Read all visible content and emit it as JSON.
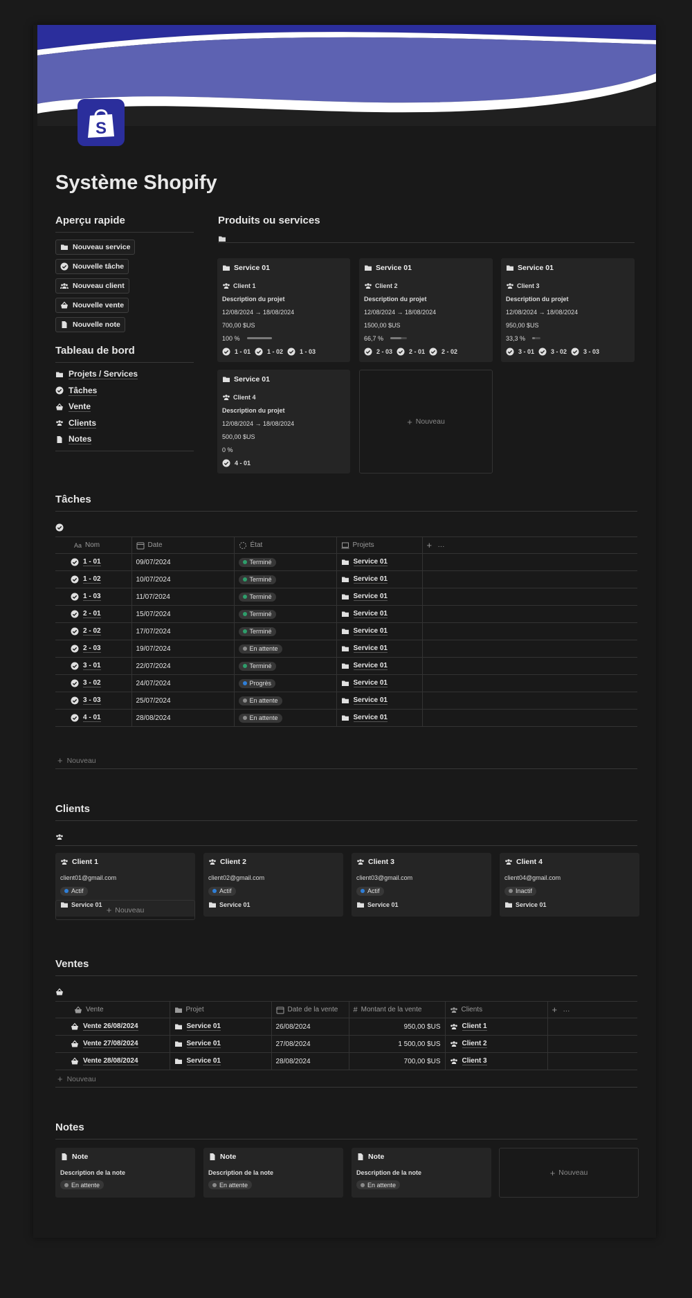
{
  "page": {
    "title": "Système Shopify"
  },
  "quick": {
    "heading": "Aperçu rapide",
    "buttons": [
      "Nouveau service",
      "Nouvelle tâche",
      "Nouveau client",
      "Nouvelle vente",
      "Nouvelle note"
    ]
  },
  "dashboard": {
    "heading": "Tableau de bord",
    "items": [
      "Projets / Services",
      "Tâches",
      "Vente",
      "Clients",
      "Notes"
    ]
  },
  "products": {
    "heading": "Produits ou services",
    "new_label": "Nouveau",
    "cards": [
      {
        "title": "Service 01",
        "client": "Client 1",
        "description": "Description du projet",
        "dates": "12/08/2024 → 18/08/2024",
        "amount": "700,00 $US",
        "progress_label": "100 %",
        "progress": 1.0,
        "tasks": [
          "1 - 01",
          "1 - 02",
          "1 - 03"
        ]
      },
      {
        "title": "Service 01",
        "client": "Client 2",
        "description": "Description du projet",
        "dates": "12/08/2024 → 18/08/2024",
        "amount": "1500,00 $US",
        "progress_label": "66,7 %",
        "progress": 0.667,
        "tasks": [
          "2 - 03",
          "2 - 01",
          "2 - 02"
        ]
      },
      {
        "title": "Service 01",
        "client": "Client 3",
        "description": "Description du projet",
        "dates": "12/08/2024 → 18/08/2024",
        "amount": "950,00 $US",
        "progress_label": "33,3 %",
        "progress": 0.333,
        "tasks": [
          "3 - 01",
          "3 - 02",
          "3 - 03"
        ]
      },
      {
        "title": "Service 01",
        "client": "Client 4",
        "description": "Description du projet",
        "dates": "12/08/2024 → 18/08/2024",
        "amount": "500,00 $US",
        "progress_label": "0 %",
        "progress": 0,
        "tasks": [
          "4 - 01"
        ]
      }
    ]
  },
  "tasks": {
    "heading": "Tâches",
    "columns": [
      "Nom",
      "Date",
      "État",
      "Projets"
    ],
    "new_label": "Nouveau",
    "rows": [
      {
        "name": "1 - 01",
        "date": "09/07/2024",
        "status": "Terminé",
        "status_color": "#2e9e6b",
        "project": "Service 01"
      },
      {
        "name": "1 - 02",
        "date": "10/07/2024",
        "status": "Terminé",
        "status_color": "#2e9e6b",
        "project": "Service 01"
      },
      {
        "name": "1 - 03",
        "date": "11/07/2024",
        "status": "Terminé",
        "status_color": "#2e9e6b",
        "project": "Service 01"
      },
      {
        "name": "2 - 01",
        "date": "15/07/2024",
        "status": "Terminé",
        "status_color": "#2e9e6b",
        "project": "Service 01"
      },
      {
        "name": "2 - 02",
        "date": "17/07/2024",
        "status": "Terminé",
        "status_color": "#2e9e6b",
        "project": "Service 01"
      },
      {
        "name": "2 - 03",
        "date": "19/07/2024",
        "status": "En attente",
        "status_color": "#8a8a8a",
        "project": "Service 01"
      },
      {
        "name": "3 - 01",
        "date": "22/07/2024",
        "status": "Terminé",
        "status_color": "#2e9e6b",
        "project": "Service 01"
      },
      {
        "name": "3 - 02",
        "date": "24/07/2024",
        "status": "Progrès",
        "status_color": "#2f7fd8",
        "project": "Service 01"
      },
      {
        "name": "3 - 03",
        "date": "25/07/2024",
        "status": "En attente",
        "status_color": "#8a8a8a",
        "project": "Service 01"
      },
      {
        "name": "4 - 01",
        "date": "28/08/2024",
        "status": "En attente",
        "status_color": "#8a8a8a",
        "project": "Service 01"
      }
    ]
  },
  "clients": {
    "heading": "Clients",
    "new_label": "Nouveau",
    "cards": [
      {
        "name": "Client 1",
        "email": "client01@gmail.com",
        "status": "Actif",
        "status_color": "#2f7fd8",
        "project": "Service 01"
      },
      {
        "name": "Client 2",
        "email": "client02@gmail.com",
        "status": "Actif",
        "status_color": "#2f7fd8",
        "project": "Service 01"
      },
      {
        "name": "Client 3",
        "email": "client03@gmail.com",
        "status": "Actif",
        "status_color": "#2f7fd8",
        "project": "Service 01"
      },
      {
        "name": "Client 4",
        "email": "client04@gmail.com",
        "status": "Inactif",
        "status_color": "#8a8a8a",
        "project": "Service 01"
      }
    ]
  },
  "sales": {
    "heading": "Ventes",
    "columns": [
      "Vente",
      "Projet",
      "Date de la vente",
      "Montant de la vente",
      "Clients"
    ],
    "new_label": "Nouveau",
    "rows": [
      {
        "name": "Vente 26/08/2024",
        "project": "Service 01",
        "date": "26/08/2024",
        "amount": "950,00 $US",
        "client": "Client 1"
      },
      {
        "name": "Vente 27/08/2024",
        "project": "Service 01",
        "date": "27/08/2024",
        "amount": "1 500,00 $US",
        "client": "Client 2"
      },
      {
        "name": "Vente 28/08/2024",
        "project": "Service 01",
        "date": "28/08/2024",
        "amount": "700,00 $US",
        "client": "Client 3"
      }
    ]
  },
  "notes": {
    "heading": "Notes",
    "new_label": "Nouveau",
    "cards": [
      {
        "title": "Note",
        "description": "Description de la note",
        "status": "En attente"
      },
      {
        "title": "Note",
        "description": "Description de la note",
        "status": "En attente"
      },
      {
        "title": "Note",
        "description": "Description de la note",
        "status": "En attente"
      }
    ]
  },
  "colors": {
    "banner_dark": "#2b2e9c",
    "banner_light": "#5d62b2",
    "logo_bg": "#2b2e9c"
  }
}
